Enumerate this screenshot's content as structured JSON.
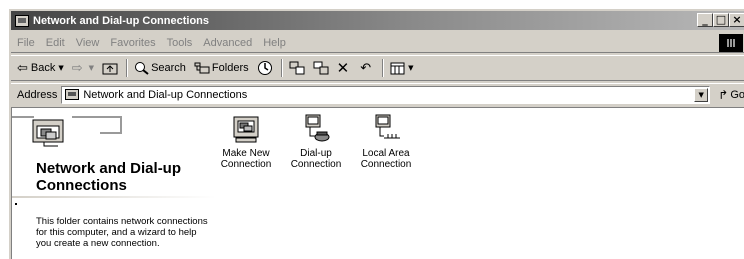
{
  "window": {
    "title": "Network and Dial-up Connections",
    "buttons": [
      "_",
      "□",
      "×"
    ]
  },
  "menu": [
    "File",
    "Edit",
    "View",
    "Favorites",
    "Tools",
    "Advanced",
    "Help"
  ],
  "toolbar": {
    "back": "Back",
    "search": "Search",
    "folders": "Folders"
  },
  "address": {
    "label": "Address",
    "value": "Network and Dial-up Connections",
    "go": "Go"
  },
  "leftpane": {
    "title_line1": "Network and Dial-up",
    "title_line2": "Connections",
    "description": "This folder contains network connections for this computer, and a wizard to help you create a new connection."
  },
  "items": [
    {
      "line1": "Make New",
      "line2": "Connection",
      "icon": "make-new-connection-icon"
    },
    {
      "line1": "Dial-up",
      "line2": "Connection",
      "icon": "dialup-connection-icon"
    },
    {
      "line1": "Local Area",
      "line2": "Connection",
      "icon": "local-area-connection-icon"
    }
  ]
}
